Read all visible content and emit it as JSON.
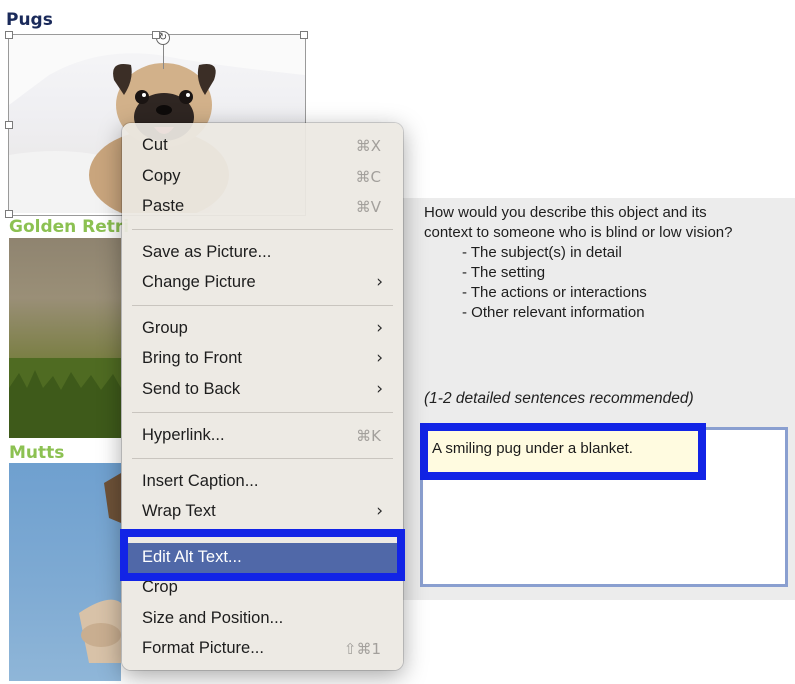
{
  "document": {
    "headings": {
      "pugs": "Pugs",
      "golden": "Golden Retri",
      "mutts": "Mutts"
    }
  },
  "alt_text_panel": {
    "question_line1": "How would you describe this object and its",
    "question_line2": "context to someone who is blind or low vision?",
    "bullets": [
      "- The subject(s) in detail",
      "- The setting",
      "- The actions or interactions",
      "- Other relevant information"
    ],
    "recommendation": "(1-2 detailed sentences recommended)",
    "alt_text_value": "A smiling pug under a blanket."
  },
  "context_menu": {
    "items": [
      {
        "label": "Cut",
        "shortcut": "⌘X"
      },
      {
        "label": "Copy",
        "shortcut": "⌘C"
      },
      {
        "label": "Paste",
        "shortcut": "⌘V"
      },
      {
        "label": "Save as Picture..."
      },
      {
        "label": "Change Picture",
        "submenu": "›"
      },
      {
        "label": "Group",
        "submenu": "›"
      },
      {
        "label": "Bring to Front",
        "submenu": "›"
      },
      {
        "label": "Send to Back",
        "submenu": "›"
      },
      {
        "label": "Hyperlink...",
        "shortcut": "⌘K"
      },
      {
        "label": "Insert Caption..."
      },
      {
        "label": "Wrap Text",
        "submenu": "›"
      },
      {
        "label": "Edit Alt Text..."
      },
      {
        "label": "Crop"
      },
      {
        "label": "Size and Position..."
      },
      {
        "label": "Format Picture...",
        "shortcut": "⇧⌘1"
      }
    ],
    "active_item": "Edit Alt Text..."
  },
  "colors": {
    "highlight_border": "#1224e6",
    "menu_active": "#5068a8",
    "heading_navy": "#1a2a5a",
    "heading_green": "#8cc152"
  },
  "icons": {
    "rotate_handle": "rotate-icon",
    "submenu_arrow": "chevron-right-icon"
  }
}
